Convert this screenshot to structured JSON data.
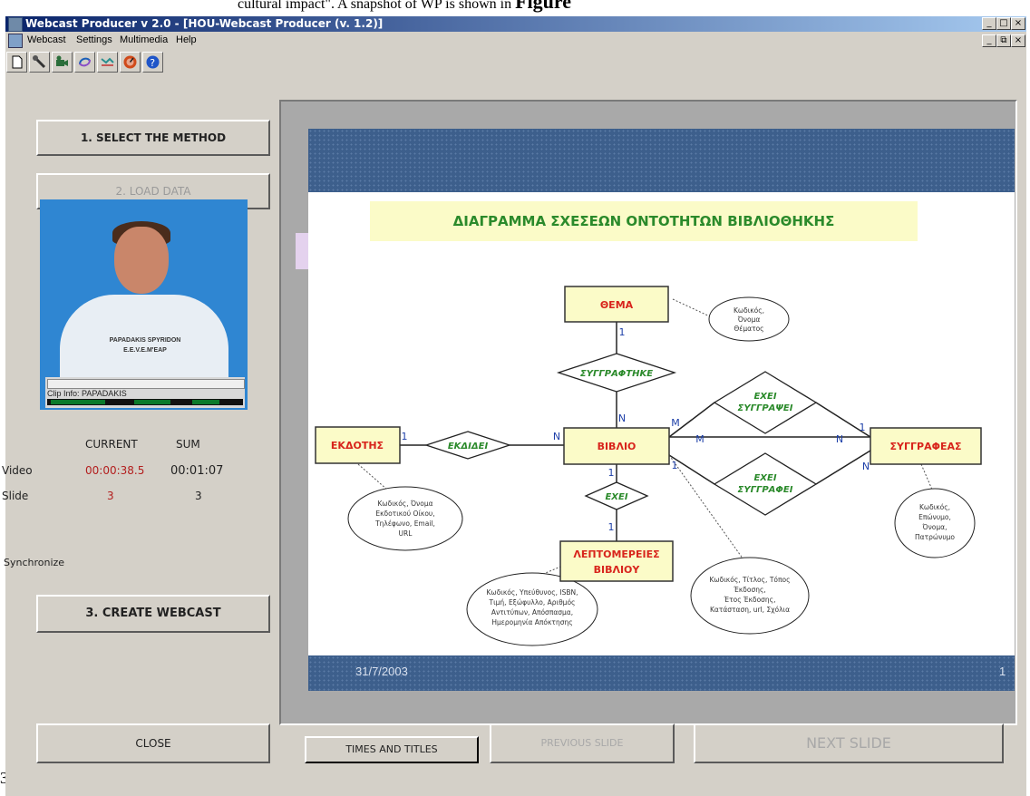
{
  "caption": {
    "text_before": "cultural impact\". A snapshot of WP is shown in ",
    "bold": "Figure",
    "footnote_number": "3"
  },
  "window": {
    "title": "Webcast Producer v 2.0 - [HOU-Webcast Producer (v. 1.2)]",
    "controls": {
      "minimize": "_",
      "maximize": "□",
      "close": "×",
      "restore": "⧉"
    }
  },
  "menu": [
    "Webcast",
    "Settings",
    "Multimedia",
    "Help"
  ],
  "toolbar_icons": [
    "new-document-icon",
    "tools-icon",
    "camera-icon",
    "refresh-icon",
    "chart-icon",
    "record-icon",
    "help-icon"
  ],
  "left_panel": {
    "select_method": "1. SELECT THE METHOD",
    "load_data": "2. LOAD DATA",
    "video_label": "PAPADAKIS SPYRIDON\nE.E.V.E.M'EAP",
    "clip_info": "Clip Info: PAPADAKIS",
    "col_current": "CURRENT",
    "col_sum": "SUM",
    "row_video": "Video",
    "row_slide": "Slide",
    "video_current": "00:00:38.5",
    "video_sum": "00:01:07",
    "slide_current": "3",
    "slide_sum": "3",
    "synchronize": "Synchronize",
    "create_webcast": "3. CREATE WEBCAST",
    "close": "CLOSE"
  },
  "slide": {
    "title": "ΔΙΑΓΡΑΜΜΑ ΣΧΕΣΕΩΝ ΟΝΤΟΤΗΤΩΝ ΒΙΒΛΙΟΘΗΚΗΣ",
    "date": "31/7/2003",
    "page": "1",
    "entities": {
      "thema": "ΘΕΜΑ",
      "ekdotis": "ΕΚΔΟΤΗΣ",
      "vivlio": "ΒΙΒΛΙΟ",
      "syggrafeas": "ΣΥΓΓΡΑΦΕΑΣ",
      "leptomereies_1": "ΛΕΠΤΟΜΕΡΕΙΕΣ",
      "leptomereies_2": "ΒΙΒΛΙΟΥ"
    },
    "relations": {
      "syggrafthike": "ΣΥΓΓΡΑΦΤΗΚΕ",
      "ekdidei": "ΕΚΔΙΔΕΙ",
      "exei": "ΕΧΕΙ",
      "exei_syggrapsei_1": "ΕΧΕΙ",
      "exei_syggrapsei_2": "ΣΥΓΓΡΑΨΕΙ",
      "exei_syggrafei_1": "ΕΧΕΙ",
      "exei_syggrafei_2": "ΣΥΓΓΡΑΦΕΙ"
    },
    "cardinalities": {
      "one": "1",
      "n": "N",
      "m": "M"
    },
    "attributes": {
      "thema": [
        "Κωδικός,",
        "Όνομα",
        "Θέματος"
      ],
      "ekdotis": [
        "Κωδικός, Όνομα",
        "Εκδοτικού Οίκου,",
        "Τηλέφωνο, Email,",
        "URL"
      ],
      "leptomereies": [
        "Κωδικός, Υπεύθυνος, ISBN,",
        "Τιμή, Εξώφυλλο, Αριθμός",
        "Αντιτύπων, Απόσπασμα,",
        "Ημερομηνία Απόκτησης"
      ],
      "vivlio": [
        "Κωδικός, Τίτλος, Τόπος",
        "Έκδοσης,",
        "Έτος Έκδοσης,",
        "Κατάσταση, url, Σχόλια"
      ],
      "syggrafeas": [
        "Κωδικός,",
        "Επώνυμο,",
        "Όνομα,",
        "Πατρώνυμο"
      ]
    }
  },
  "bottom_buttons": {
    "times_and_titles": "TIMES AND TITLES",
    "previous_slide": "PREVIOUS SLIDE",
    "next_slide": "NEXT SLIDE"
  }
}
